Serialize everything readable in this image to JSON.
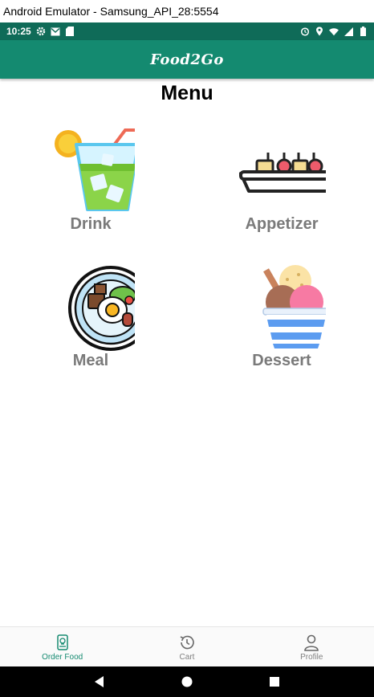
{
  "window": {
    "title": "Android Emulator - Samsung_API_28:5554"
  },
  "status_bar": {
    "time": "10:25",
    "background": "#0f6b58"
  },
  "app_bar": {
    "title": "Food2Go",
    "background": "#148a70"
  },
  "page": {
    "title": "Menu"
  },
  "menu": {
    "items": [
      {
        "label": "Drink",
        "icon": "drink-icon"
      },
      {
        "label": "Appetizer",
        "icon": "appetizer-icon"
      },
      {
        "label": "Meal",
        "icon": "meal-icon"
      },
      {
        "label": "Dessert",
        "icon": "dessert-icon"
      }
    ]
  },
  "bottom_nav": {
    "items": [
      {
        "label": "Order Food",
        "icon": "order-food-icon",
        "active": true
      },
      {
        "label": "Cart",
        "icon": "history-icon",
        "active": false
      },
      {
        "label": "Profile",
        "icon": "profile-icon",
        "active": false
      }
    ],
    "active_color": "#148a70"
  },
  "system_nav": {
    "buttons": [
      "back-icon",
      "home-icon",
      "recents-icon"
    ]
  }
}
